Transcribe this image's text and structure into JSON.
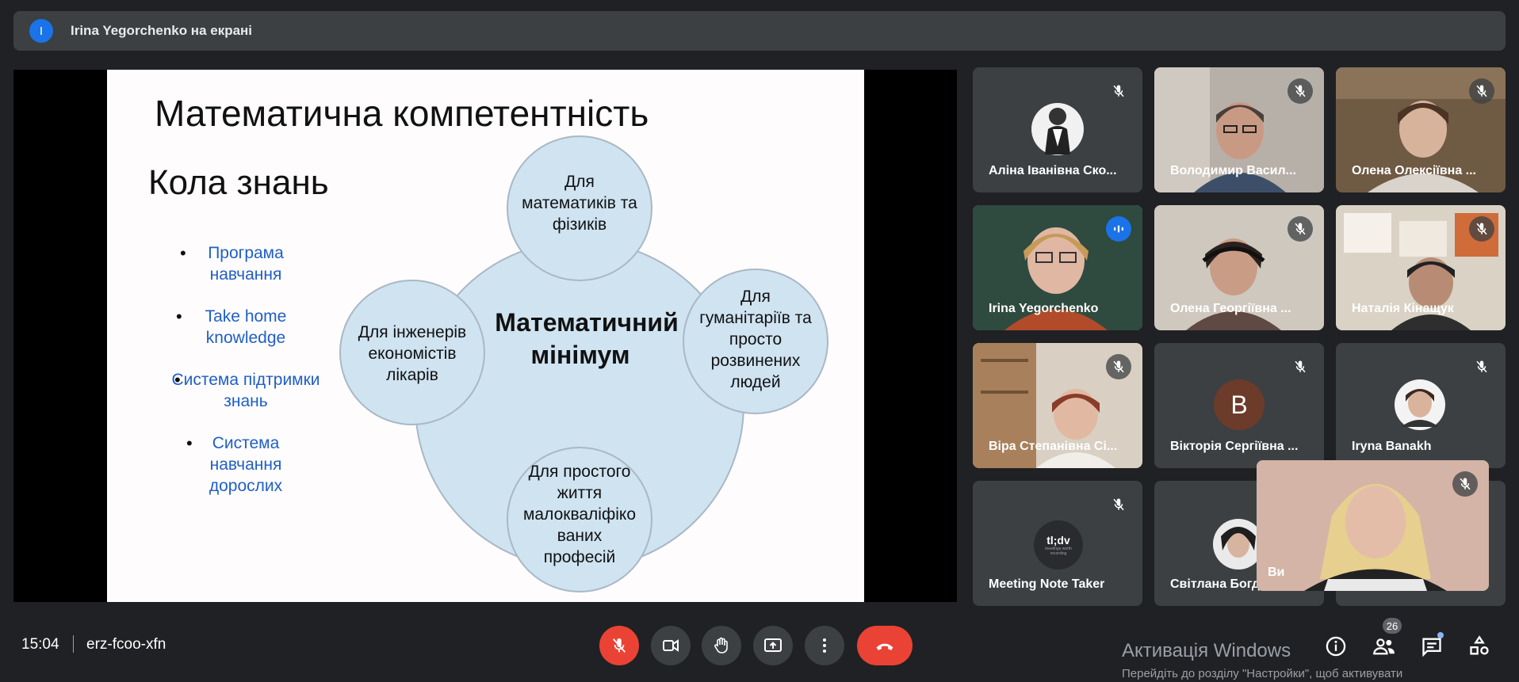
{
  "banner": {
    "avatar_letter": "I",
    "text": "Irina Yegorchenko на екрані"
  },
  "slide": {
    "title": "Математична компетентність",
    "subtitle": "Кола знань",
    "bullets": [
      "Програма навчання",
      "Take home knowledge",
      "Система підтримки знань",
      "Система навчання дорослих"
    ],
    "center_line1": "Математичний",
    "center_line2": "мінімум",
    "circles": [
      {
        "line1": "Для",
        "line2": "математиків та",
        "line3": "фізиків"
      },
      {
        "line1": "Для інженерів",
        "line2": "економістів",
        "line3": "лікарів"
      },
      {
        "line1": "Для",
        "line2": "гуманітаріїв та",
        "line3": "просто",
        "line4": "розвинених",
        "line5": "людей"
      },
      {
        "line1": "Для простого",
        "line2": "життя",
        "line3": "малокваліфіко",
        "line4": "ваних",
        "line5": "професій"
      }
    ],
    "colors": {
      "circle_fill": "#cfe3f1",
      "circle_stroke": "#a9b8c4",
      "bullet_text": "#1f5fc6"
    }
  },
  "participants": [
    {
      "name": "Аліна Іванівна Ско..."
    },
    {
      "name": "Володимир Васил..."
    },
    {
      "name": "Олена Олексіївна ..."
    },
    {
      "name": "Irina Yegorchenko",
      "speaking": true
    },
    {
      "name": "Олена Георгіївна ..."
    },
    {
      "name": "Наталія Кінащук"
    },
    {
      "name": "Віра Степанівна Сі..."
    },
    {
      "name": "Вікторія Сергіївна ...",
      "avatar_letter": "B"
    },
    {
      "name": "Iryna Banakh"
    },
    {
      "name": "Meeting Note Taker",
      "avatar_title": "tl;dv",
      "avatar_tagline": "meetings worth recording"
    },
    {
      "name": "Світлана Богд"
    }
  ],
  "self_view": {
    "label": "Ви"
  },
  "bottom_bar": {
    "time": "15:04",
    "meeting_code": "erz-fcoo-xfn",
    "participant_count": "26"
  },
  "watermark": {
    "title": "Активація Windows",
    "subtitle": "Перейдіть до розділу \"Настройки\", щоб активувати"
  },
  "icons": {
    "mic": "mic-off-icon",
    "camera": "video-camera-icon",
    "hand": "raise-hand-icon",
    "present": "present-screen-icon",
    "more": "more-vert-icon",
    "end": "end-call-icon",
    "info": "info-icon",
    "people": "people-icon",
    "chat": "chat-icon",
    "activities": "activities-icon"
  },
  "colors": {
    "accent": "#8ab4f8",
    "danger": "#ea4335",
    "surface": "#3c4043",
    "background": "#202124"
  }
}
